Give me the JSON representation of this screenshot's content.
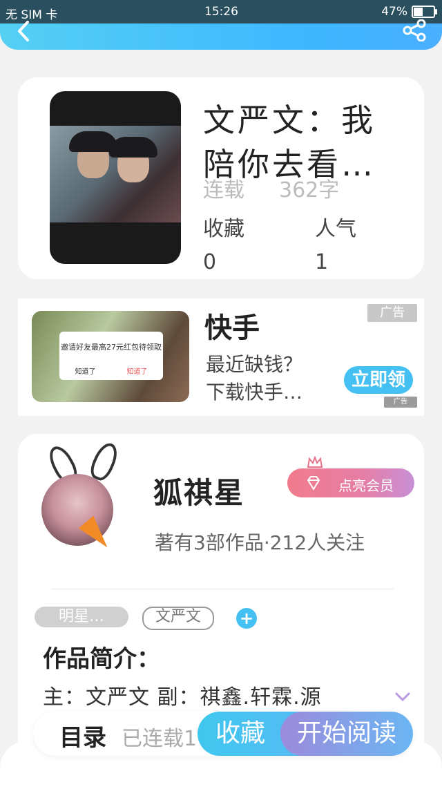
{
  "status_bar": {
    "carrier": "无 SIM 卡",
    "time": "15:26",
    "battery": "47%",
    "battery_level": 0.47
  },
  "header": {
    "back_icon": "chevron-left-icon",
    "share_icon": "share-icon"
  },
  "book": {
    "title": "文严文：我陪你去看…",
    "status": "连载",
    "word_count": "362字",
    "favorites_label": "收藏",
    "popularity_label": "人气",
    "favorites_value": "0",
    "popularity_value": "1"
  },
  "ad": {
    "title": "快手",
    "description_line1": "最近缺钱？",
    "description_line2": "下载快手…",
    "tag": "广告",
    "cta": "立即领",
    "dialog_message": "邀请好友最高27元红包待领取",
    "dialog_ok": "知道了",
    "dialog_cta": "知道了",
    "mark": "广告"
  },
  "author": {
    "name": "狐祺星",
    "vip_label": "点亮会员",
    "meta": "著有3部作品·212人关注"
  },
  "tags": {
    "tag1": "明星…",
    "tag2": "文严文",
    "add": "+"
  },
  "intro": {
    "title": "作品简介：",
    "text": "主：文严文 副：祺鑫.轩霖.源"
  },
  "bottom": {
    "toc": "目录",
    "serial_info": "已连载1",
    "favorite_button": "收藏",
    "read_button": "开始阅读"
  }
}
